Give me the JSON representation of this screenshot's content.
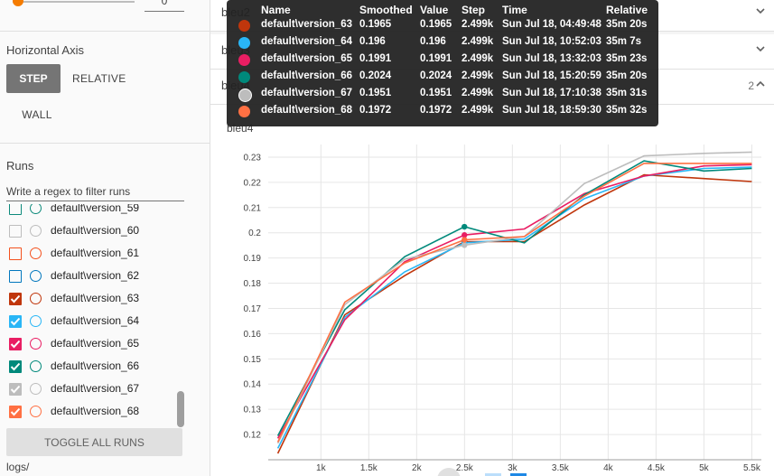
{
  "sidebar": {
    "smoothing_value": "0",
    "smoothing_fraction": 0.0,
    "horizontal_axis_label": "Horizontal Axis",
    "axis_buttons": {
      "step": "STEP",
      "relative": "RELATIVE",
      "wall": "WALL"
    },
    "runs_label": "Runs",
    "regex_placeholder": "Write a regex to filter runs",
    "runs": [
      {
        "label": "default\\version_59",
        "color": "#0d8a7b",
        "checked": false
      },
      {
        "label": "default\\version_60",
        "color": "#bdbdbd",
        "checked": false
      },
      {
        "label": "default\\version_61",
        "color": "#f4511e",
        "checked": false
      },
      {
        "label": "default\\version_62",
        "color": "#0277bd",
        "checked": false
      },
      {
        "label": "default\\version_63",
        "color": "#c0360c",
        "checked": true
      },
      {
        "label": "default\\version_64",
        "color": "#29b6f6",
        "checked": true
      },
      {
        "label": "default\\version_65",
        "color": "#e91e63",
        "checked": true
      },
      {
        "label": "default\\version_66",
        "color": "#00897b",
        "checked": true
      },
      {
        "label": "default\\version_67",
        "color": "#bdbdbd",
        "checked": true
      },
      {
        "label": "default\\version_68",
        "color": "#ff7043",
        "checked": true
      }
    ],
    "toggle_all_label": "TOGGLE ALL RUNS",
    "logdir": "logs/"
  },
  "cards": [
    {
      "title": "bleu2",
      "count": ""
    },
    {
      "title": "bleu3",
      "count": ""
    },
    {
      "title": "bleu4",
      "count": "2"
    }
  ],
  "chart_title": "bleu4",
  "tooltip": {
    "headers": {
      "name": "Name",
      "smoothed": "Smoothed",
      "value": "Value",
      "step": "Step",
      "time": "Time",
      "relative": "Relative"
    },
    "rows": [
      {
        "color": "#c0360c",
        "name": "default\\version_63",
        "smoothed": "0.1965",
        "value": "0.1965",
        "step": "2.499k",
        "time": "Sun Jul 18, 04:49:48",
        "relative": "35m 20s"
      },
      {
        "color": "#29b6f6",
        "name": "default\\version_64",
        "smoothed": "0.196",
        "value": "0.196",
        "step": "2.499k",
        "time": "Sun Jul 18, 10:52:03",
        "relative": "35m 7s"
      },
      {
        "color": "#e91e63",
        "name": "default\\version_65",
        "smoothed": "0.1991",
        "value": "0.1991",
        "step": "2.499k",
        "time": "Sun Jul 18, 13:32:03",
        "relative": "35m 23s"
      },
      {
        "color": "#00897b",
        "name": "default\\version_66",
        "smoothed": "0.2024",
        "value": "0.2024",
        "step": "2.499k",
        "time": "Sun Jul 18, 15:20:59",
        "relative": "35m 20s"
      },
      {
        "color": "#bdbdbd",
        "name": "default\\version_67",
        "smoothed": "0.1951",
        "value": "0.1951",
        "step": "2.499k",
        "time": "Sun Jul 18, 17:10:38",
        "relative": "35m 31s"
      },
      {
        "color": "#ff7043",
        "name": "default\\version_68",
        "smoothed": "0.1972",
        "value": "0.1972",
        "step": "2.499k",
        "time": "Sun Jul 18, 18:59:30",
        "relative": "35m 32s"
      }
    ]
  },
  "chart_data": {
    "type": "line",
    "title": "bleu4",
    "xlabel": "",
    "ylabel": "",
    "xlim": [
      450,
      5600
    ],
    "ylim": [
      0.11,
      0.235
    ],
    "x_ticks": [
      1000,
      1500,
      2000,
      2500,
      3000,
      3500,
      4000,
      4500,
      5000,
      5500
    ],
    "x_tick_labels": [
      "1k",
      "1.5k",
      "2k",
      "2.5k",
      "3k",
      "3.5k",
      "4k",
      "4.5k",
      "5k",
      "5.5k"
    ],
    "y_ticks": [
      0.12,
      0.13,
      0.14,
      0.15,
      0.16,
      0.17,
      0.18,
      0.19,
      0.2,
      0.21,
      0.22,
      0.23
    ],
    "y_tick_labels": [
      "0.12",
      "0.13",
      "0.14",
      "0.15",
      "0.16",
      "0.17",
      "0.18",
      "0.19",
      "0.2",
      "0.21",
      "0.22",
      "0.23"
    ],
    "grid": true,
    "highlight_step": 2499,
    "series": [
      {
        "name": "default\\version_63",
        "color": "#c0360c",
        "x": [
          550,
          1250,
          1875,
          2499,
          3125,
          3750,
          4375,
          5000,
          5500
        ],
        "y": [
          0.1125,
          0.1675,
          0.183,
          0.1965,
          0.1965,
          0.211,
          0.223,
          0.2215,
          0.2203
        ]
      },
      {
        "name": "default\\version_64",
        "color": "#29b6f6",
        "x": [
          550,
          1250,
          1875,
          2499,
          3125,
          3750,
          4375,
          5000,
          5500
        ],
        "y": [
          0.1145,
          0.1665,
          0.1845,
          0.196,
          0.1975,
          0.2135,
          0.2225,
          0.2255,
          0.226
        ]
      },
      {
        "name": "default\\version_65",
        "color": "#e91e63",
        "x": [
          550,
          1250,
          1875,
          2499,
          3125,
          3750,
          4375,
          5000,
          5500
        ],
        "y": [
          0.1185,
          0.1655,
          0.1885,
          0.1991,
          0.2015,
          0.2155,
          0.2225,
          0.2265,
          0.227
        ]
      },
      {
        "name": "default\\version_66",
        "color": "#00897b",
        "x": [
          550,
          1250,
          1875,
          2499,
          3125,
          3750,
          4375,
          5000,
          5500
        ],
        "y": [
          0.1195,
          0.1695,
          0.1905,
          0.2024,
          0.196,
          0.215,
          0.2285,
          0.2245,
          0.2255
        ]
      },
      {
        "name": "default\\version_67",
        "color": "#bdbdbd",
        "x": [
          550,
          1250,
          1875,
          2499,
          3125,
          3750,
          4375,
          5000,
          5500
        ],
        "y": [
          0.1165,
          0.1715,
          0.1895,
          0.1951,
          0.1985,
          0.2195,
          0.2305,
          0.2315,
          0.232
        ]
      },
      {
        "name": "default\\version_68",
        "color": "#ff7043",
        "x": [
          550,
          1250,
          1875,
          2499,
          3125,
          3750,
          4375,
          5000,
          5500
        ],
        "y": [
          0.117,
          0.1725,
          0.188,
          0.1972,
          0.1985,
          0.2145,
          0.2275,
          0.2275,
          0.2275
        ]
      }
    ]
  }
}
